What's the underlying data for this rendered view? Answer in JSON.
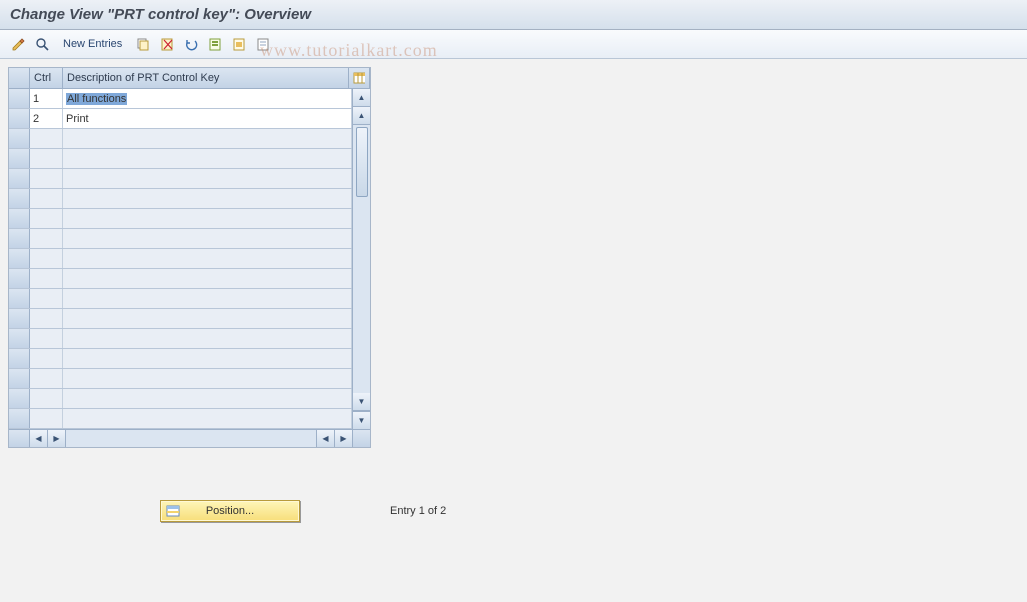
{
  "title": "Change View \"PRT control key\": Overview",
  "toolbar": {
    "new_entries_label": "New Entries"
  },
  "grid": {
    "columns": {
      "ctrl": "Ctrl",
      "desc": "Description of PRT Control Key"
    },
    "rows": [
      {
        "ctrl": "1",
        "desc": "All functions",
        "selected": true
      },
      {
        "ctrl": "2",
        "desc": "Print",
        "selected": false
      }
    ],
    "empty_rows": 15
  },
  "footer": {
    "position_label": "Position...",
    "status": "Entry 1 of 2"
  },
  "watermark": "www.tutorialkart.com"
}
